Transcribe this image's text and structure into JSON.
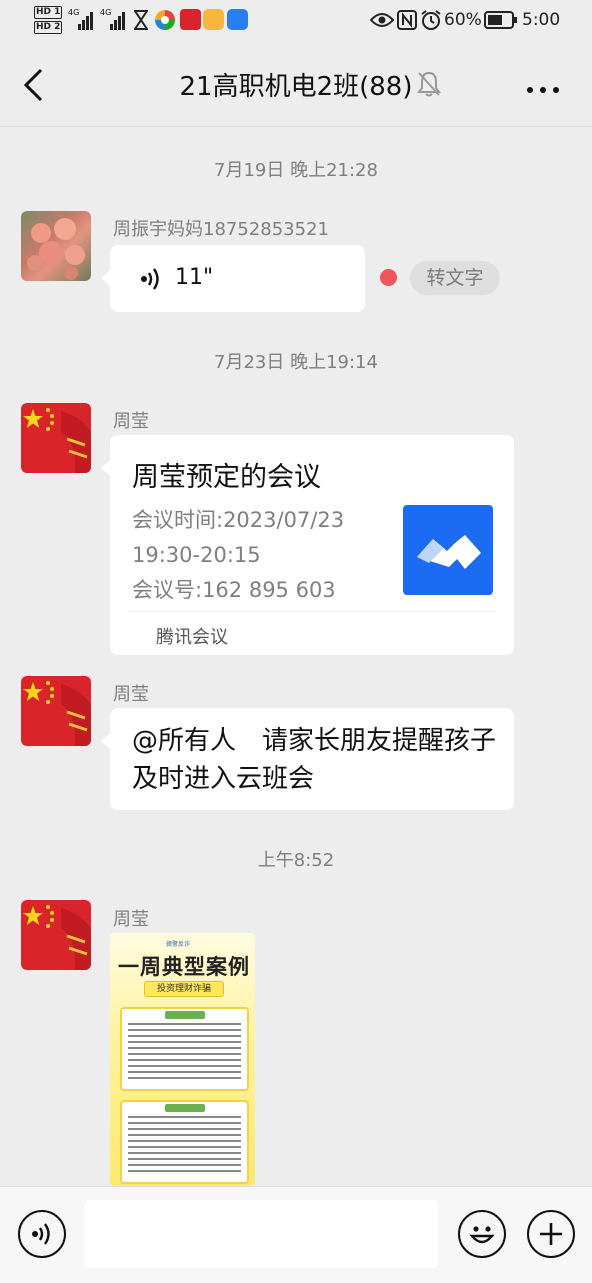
{
  "status_bar": {
    "hd1": "HD 1",
    "hd2": "HD 2",
    "net1": "4G",
    "net2": "4G",
    "battery": "60%",
    "time": "5:00"
  },
  "header": {
    "title": "21高职机电2班(88)"
  },
  "messages": [
    {
      "time": "7月19日 晚上21:28"
    },
    {
      "sender": "周振宇妈妈18752853521",
      "voice_duration": "11\"",
      "convert_label": "转文字"
    },
    {
      "time": "7月23日 晚上19:14"
    },
    {
      "sender": "周莹",
      "card_title": "周莹预定的会议",
      "card_line1": "会议时间:2023/07/23",
      "card_line2": "19:30-20:15",
      "card_line3": "会议号:162 895 603",
      "card_source": "腾讯会议"
    },
    {
      "sender": "周莹",
      "text": "@所有人　请家长朋友提醒孩子及时进入云班会"
    },
    {
      "time": "上午8:52"
    },
    {
      "sender": "周莹",
      "image_title": "一周典型案例",
      "image_sub": "投资理财诈骗",
      "image_brand": "赣警反诈"
    }
  ],
  "colors": {
    "background": "#ededed",
    "unread_dot": "#f0545c",
    "meeting_blue": "#1b6cf2"
  }
}
